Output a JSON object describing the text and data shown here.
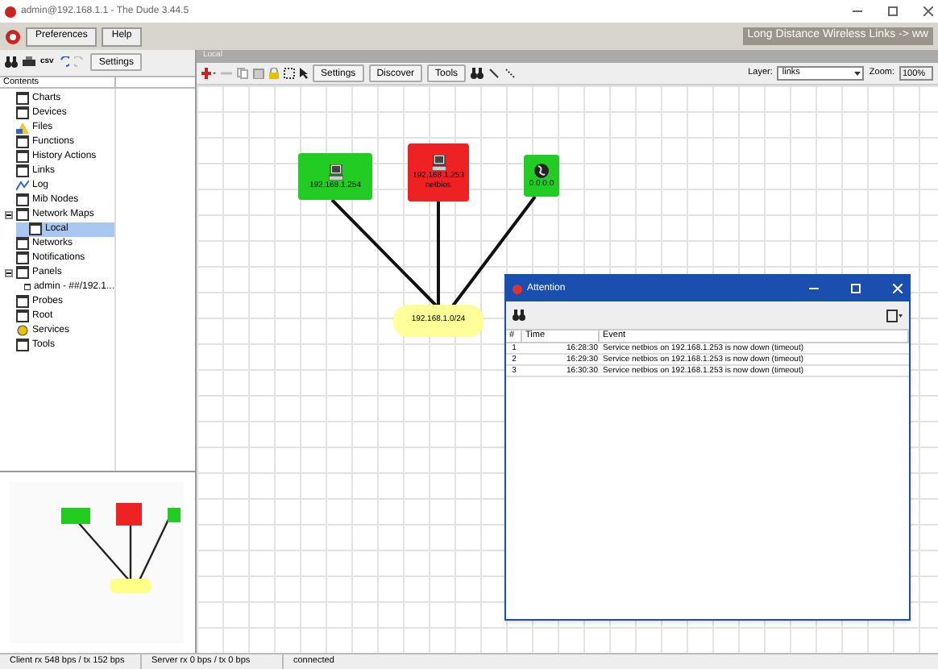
{
  "window": {
    "title": "admin@192.168.1.1 - The Dude 3.44.5"
  },
  "menu": [
    "Preferences",
    "Help"
  ],
  "banner": "Long Distance Wireless Links -> ww",
  "left_toolbar": {
    "csv": "csv",
    "settings": "Settings"
  },
  "tree": {
    "header": "Contents",
    "items": [
      {
        "label": "Charts",
        "kind": "window"
      },
      {
        "label": "Devices",
        "kind": "window"
      },
      {
        "label": "Files",
        "kind": "files"
      },
      {
        "label": "Functions",
        "kind": "window"
      },
      {
        "label": "History Actions",
        "kind": "window"
      },
      {
        "label": "Links",
        "kind": "window"
      },
      {
        "label": "Log",
        "kind": "log"
      },
      {
        "label": "Mib Nodes",
        "kind": "window"
      },
      {
        "label": "Network Maps",
        "kind": "window",
        "expanded": true,
        "children": [
          {
            "label": "Local",
            "kind": "window",
            "selected": true
          }
        ]
      },
      {
        "label": "Networks",
        "kind": "window"
      },
      {
        "label": "Notifications",
        "kind": "window"
      },
      {
        "label": "Panels",
        "kind": "window",
        "expanded": true,
        "children": [
          {
            "label": "admin - ##/192.1...",
            "kind": "window",
            "selected": false
          }
        ]
      },
      {
        "label": "Probes",
        "kind": "window"
      },
      {
        "label": "Root",
        "kind": "window"
      },
      {
        "label": "Services",
        "kind": "services"
      },
      {
        "label": "Tools",
        "kind": "window"
      }
    ]
  },
  "map": {
    "title": "Local",
    "toolbar": {
      "buttons": [
        "Settings",
        "Discover",
        "Tools"
      ],
      "layer_label": "Layer:",
      "layer_value": "links",
      "zoom_label": "Zoom:",
      "zoom_value": "100%"
    },
    "nodes": [
      {
        "kind": "device",
        "lines": [
          "192.168.1.254"
        ],
        "color": "#22cc22"
      },
      {
        "kind": "device",
        "lines": [
          "192.168.1.253",
          "netbios"
        ],
        "color": "#ee2222"
      },
      {
        "kind": "globe",
        "lines": [
          "0.0.0.0"
        ],
        "color": "#22cc22"
      }
    ],
    "network": {
      "label": "192.168.1.0/24"
    }
  },
  "attention": {
    "title": "Attention",
    "columns": [
      "#",
      "Time",
      "Event"
    ],
    "rows": [
      {
        "n": "1",
        "time": "16:28:30",
        "event": "Service netbios on 192.168.1.253 is now down (timeout)"
      },
      {
        "n": "2",
        "time": "16:29:30",
        "event": "Service netbios on 192.168.1.253 is now down (timeout)"
      },
      {
        "n": "3",
        "time": "16:30:30",
        "event": "Service netbios on 192.168.1.253 is now down (timeout)"
      }
    ]
  },
  "status_bar": [
    "Client rx 548 bps / tx 152 bps",
    "Server rx 0 bps / tx 0 bps",
    "connected"
  ]
}
